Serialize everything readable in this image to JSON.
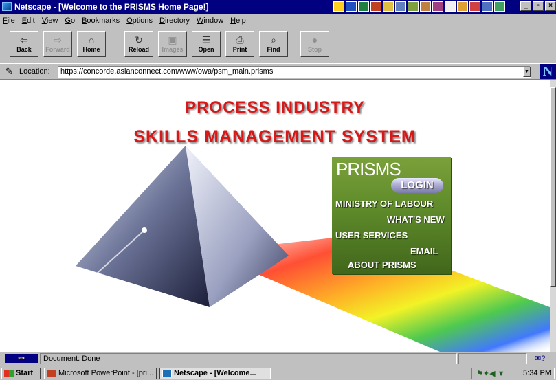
{
  "window": {
    "title": "Netscape - [Welcome to the PRISMS Home Page!]"
  },
  "menu": [
    "File",
    "Edit",
    "View",
    "Go",
    "Bookmarks",
    "Options",
    "Directory",
    "Window",
    "Help"
  ],
  "toolbar": {
    "back": "Back",
    "forward": "Forward",
    "home": "Home",
    "reload": "Reload",
    "images": "Images",
    "open": "Open",
    "print": "Print",
    "find": "Find",
    "stop": "Stop"
  },
  "location": {
    "label": "Location:",
    "url": "https://concorde.asianconnect.com/www/owa/psm_main.prisms"
  },
  "page": {
    "headline_1": "PROCESS INDUSTRY",
    "headline_2": "SKILLS MANAGEMENT SYSTEM",
    "logo": "PRISMS",
    "login": "LOGIN",
    "links": {
      "ministry": "MINISTRY OF LABOUR",
      "whats_new": "WHAT'S NEW",
      "user_services": "USER SERVICES",
      "email": "EMAIL",
      "about": "ABOUT PRISMS"
    }
  },
  "status": {
    "text": "Document: Done"
  },
  "taskbar": {
    "start": "Start",
    "tasks": [
      "Microsoft PowerPoint - [pri...",
      "Netscape - [Welcome..."
    ],
    "clock": "5:34 PM"
  },
  "icons": {
    "back": "left-arrow-icon",
    "forward": "right-arrow-icon",
    "home": "house-icon",
    "reload": "reload-icon",
    "images": "images-icon",
    "open": "open-icon",
    "print": "printer-icon",
    "find": "binoculars-icon",
    "stop": "stop-icon",
    "location": "bookmark-quill-icon",
    "security": "key-icon",
    "mail": "envelope-icon"
  },
  "colors": {
    "titlebar": "#000080",
    "headline": "#d81818",
    "menu_panel": "#5e8a2a",
    "chrome": "#c0c0c0"
  }
}
